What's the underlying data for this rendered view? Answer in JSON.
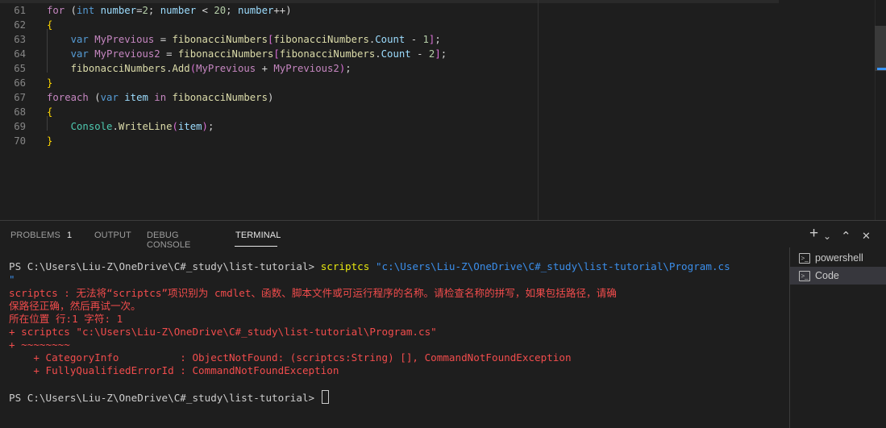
{
  "editor": {
    "lines": [
      {
        "n": "61",
        "tokens": [
          [
            "for",
            "#c586c0"
          ],
          [
            " (",
            ""
          ],
          [
            "int",
            "#569cd6"
          ],
          [
            " ",
            ""
          ],
          [
            "number",
            "#9cdcfe"
          ],
          [
            "=",
            ""
          ],
          [
            "2",
            "#b5cea8"
          ],
          [
            "; ",
            ""
          ],
          [
            "number",
            "#9cdcfe"
          ],
          [
            " < ",
            ""
          ],
          [
            "20",
            "#b5cea8"
          ],
          [
            "; ",
            ""
          ],
          [
            "number",
            "#9cdcfe"
          ],
          [
            "++)",
            ""
          ]
        ]
      },
      {
        "n": "62",
        "tokens": [
          [
            "{",
            "#ffd700"
          ]
        ]
      },
      {
        "n": "63",
        "tokens": [
          [
            "    ",
            ""
          ],
          [
            "var",
            "#569cd6"
          ],
          [
            " ",
            ""
          ],
          [
            "MyPrevious",
            "#c586c0"
          ],
          [
            " = ",
            ""
          ],
          [
            "fibonacciNumbers",
            "#dcdcaa"
          ],
          [
            "[",
            "#da70d6"
          ],
          [
            "fibonacciNumbers",
            "#dcdcaa"
          ],
          [
            ".",
            ""
          ],
          [
            "Count",
            "#9cdcfe"
          ],
          [
            " - ",
            ""
          ],
          [
            "1",
            "#b5cea8"
          ],
          [
            "]",
            "#da70d6"
          ],
          [
            ";",
            ""
          ]
        ]
      },
      {
        "n": "64",
        "tokens": [
          [
            "    ",
            ""
          ],
          [
            "var",
            "#569cd6"
          ],
          [
            " ",
            ""
          ],
          [
            "MyPrevious2",
            "#c586c0"
          ],
          [
            " = ",
            ""
          ],
          [
            "fibonacciNumbers",
            "#dcdcaa"
          ],
          [
            "[",
            "#da70d6"
          ],
          [
            "fibonacciNumbers",
            "#dcdcaa"
          ],
          [
            ".",
            ""
          ],
          [
            "Count",
            "#9cdcfe"
          ],
          [
            " - ",
            ""
          ],
          [
            "2",
            "#b5cea8"
          ],
          [
            "]",
            "#da70d6"
          ],
          [
            ";",
            ""
          ]
        ]
      },
      {
        "n": "65",
        "tokens": [
          [
            "    ",
            ""
          ],
          [
            "fibonacciNumbers",
            "#dcdcaa"
          ],
          [
            ".",
            ""
          ],
          [
            "Add",
            "#dcdcaa"
          ],
          [
            "(",
            "#da70d6"
          ],
          [
            "MyPrevious",
            "#c586c0"
          ],
          [
            " + ",
            ""
          ],
          [
            "MyPrevious2",
            "#c586c0"
          ],
          [
            ")",
            "#da70d6"
          ],
          [
            ";",
            ""
          ]
        ]
      },
      {
        "n": "66",
        "tokens": [
          [
            "}",
            "#ffd700"
          ]
        ]
      },
      {
        "n": "67",
        "tokens": [
          [
            "foreach",
            "#c586c0"
          ],
          [
            " (",
            ""
          ],
          [
            "var",
            "#569cd6"
          ],
          [
            " ",
            ""
          ],
          [
            "item",
            "#9cdcfe"
          ],
          [
            " ",
            ""
          ],
          [
            "in",
            "#c586c0"
          ],
          [
            " ",
            ""
          ],
          [
            "fibonacciNumbers",
            "#dcdcaa"
          ],
          [
            ")",
            ""
          ]
        ]
      },
      {
        "n": "68",
        "tokens": [
          [
            "{",
            "#ffd700"
          ]
        ]
      },
      {
        "n": "69",
        "tokens": [
          [
            "    ",
            ""
          ],
          [
            "Console",
            "#4ec9b0"
          ],
          [
            ".",
            ""
          ],
          [
            "WriteLine",
            "#dcdcaa"
          ],
          [
            "(",
            "#da70d6"
          ],
          [
            "item",
            "#9cdcfe"
          ],
          [
            ")",
            "#da70d6"
          ],
          [
            ";",
            ""
          ]
        ]
      },
      {
        "n": "70",
        "tokens": [
          [
            "}",
            "#ffd700"
          ]
        ]
      }
    ]
  },
  "panel": {
    "tabs": {
      "problems": "PROBLEMS",
      "problems_count": "1",
      "output": "OUTPUT",
      "debug_console": "DEBUG CONSOLE",
      "terminal": "TERMINAL"
    },
    "controls": {
      "add": "+",
      "dropdown": "⌄",
      "maximize": "⌃",
      "close": "✕"
    },
    "terminals": [
      {
        "label": "powershell",
        "selected": false
      },
      {
        "label": "Code",
        "selected": true
      }
    ]
  },
  "terminal": {
    "prompt1": "PS C:\\Users\\Liu-Z\\OneDrive\\C#_study\\list-tutorial> ",
    "cmd_name": "scriptcs",
    "cmd_arg": " \"c:\\Users\\Liu-Z\\OneDrive\\C#_study\\list-tutorial\\Program.cs",
    "cmd_arg_end": "\"",
    "err1": "scriptcs : 无法将“scriptcs”项识别为 cmdlet、函数、脚本文件或可运行程序的名称。请检查名称的拼写，如果包括路径，请确",
    "err2": "保路径正确，然后再试一次。",
    "err3": "所在位置 行:1 字符: 1",
    "err4": "+ scriptcs \"c:\\Users\\Liu-Z\\OneDrive\\C#_study\\list-tutorial\\Program.cs\"",
    "err5": "+ ~~~~~~~~",
    "err6": "    + CategoryInfo          : ObjectNotFound: (scriptcs:String) [], CommandNotFoundException",
    "err7": "    + FullyQualifiedErrorId : CommandNotFoundException",
    "prompt2": "PS C:\\Users\\Liu-Z\\OneDrive\\C#_study\\list-tutorial> "
  },
  "colors": {
    "background": "#1e1e1e",
    "error": "#f14c4c",
    "command": "#e5e510",
    "string": "#3b8eea",
    "accent": "#3794ff"
  }
}
